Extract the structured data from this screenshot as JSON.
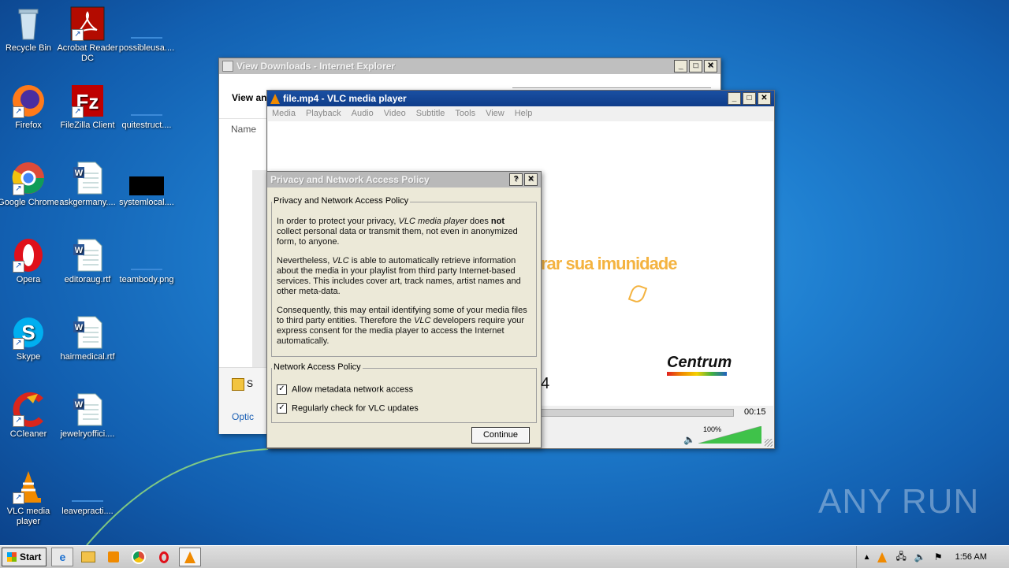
{
  "desktop": {
    "icons": [
      {
        "label": "Recycle Bin"
      },
      {
        "label": "Acrobat Reader DC"
      },
      {
        "label": "possibleusa...."
      },
      {
        "label": "Firefox"
      },
      {
        "label": "FileZilla Client"
      },
      {
        "label": "quitestruct...."
      },
      {
        "label": "Google Chrome"
      },
      {
        "label": "askgermany...."
      },
      {
        "label": "systemlocal...."
      },
      {
        "label": "Opera"
      },
      {
        "label": "editoraug.rtf"
      },
      {
        "label": "teambody.png"
      },
      {
        "label": "Skype"
      },
      {
        "label": "hairmedical.rtf"
      },
      {
        "label": "CCleaner"
      },
      {
        "label": "jewelryoffici...."
      },
      {
        "label": "VLC media player"
      },
      {
        "label": "leavepracti...."
      }
    ]
  },
  "ie_window": {
    "title": "View Downloads - Internet Explorer",
    "heading": "View an",
    "column_name": "Name",
    "footer_s": "S",
    "options_link": "Optic"
  },
  "vlc_window": {
    "title": "file.mp4 - VLC media player",
    "menu": [
      "Media",
      "Playback",
      "Audio",
      "Video",
      "Subtitle",
      "Tools",
      "View",
      "Help"
    ],
    "video_text": "rar sua imunidade",
    "brand": "Centrum",
    "partial_digit": "4",
    "time": "00:15",
    "volume": "100%",
    "volume_level": 1.0
  },
  "dialog": {
    "title": "Privacy and Network Access Policy",
    "help_btn": "?",
    "close_btn": "✕",
    "section1_legend": "Privacy and Network Access Policy",
    "p1_a": "In order to protect your privacy, ",
    "p1_em": "VLC media player",
    "p1_b": " does ",
    "p1_strong": "not",
    "p1_c": " collect personal data or transmit them, not even in anonymized form, to anyone.",
    "p2_a": "Nevertheless, ",
    "p2_em": "VLC",
    "p2_b": " is able to automatically retrieve information about the media in your playlist from third party Internet-based services. This includes cover art, track names, artist names and other meta-data.",
    "p3_a": "Consequently, this may entail identifying some of your media files to third party entities. Therefore the ",
    "p3_em": "VLC",
    "p3_b": " developers require your express consent for the media player to access the Internet automatically.",
    "section2_legend": "Network Access Policy",
    "checkbox1": "Allow metadata network access",
    "checkbox2": "Regularly check for VLC updates",
    "continue_btn": "Continue"
  },
  "taskbar": {
    "start_label": "Start",
    "clock": "1:56 AM"
  },
  "watermark": "ANY RUN",
  "colors": {
    "vlc_orange": "#f08a00",
    "centrum_orange": "#f4b340",
    "title_active": "#1a4fa2"
  }
}
